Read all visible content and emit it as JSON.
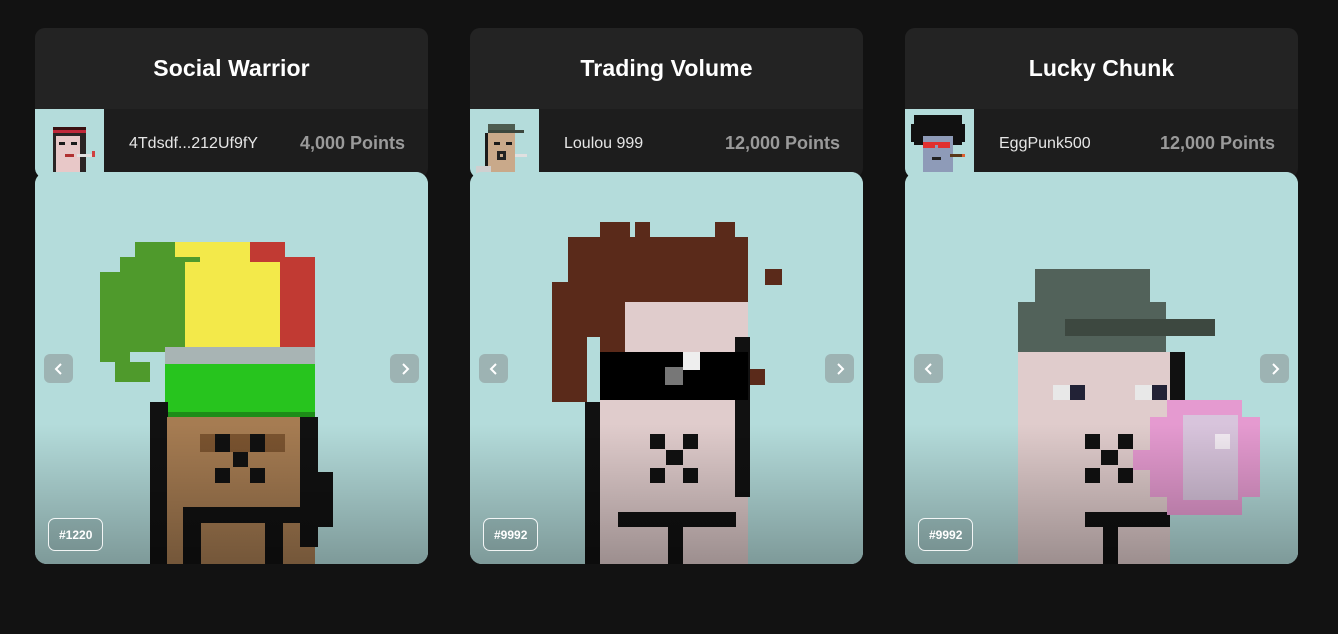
{
  "cards": [
    {
      "category": "Social Warrior",
      "winner_name": "4Tdsdf...212Uf9fY",
      "points": "4,000 Points",
      "token": "#1220",
      "avatar_icon": "punk-avatar-bandana",
      "prev_icon": "chevron-left-icon",
      "next_icon": "chevron-right-icon"
    },
    {
      "category": "Trading Volume",
      "winner_name": "Loulou 999",
      "points": "12,000 Points",
      "token": "#9992",
      "avatar_icon": "punk-avatar-cap",
      "prev_icon": "chevron-left-icon",
      "next_icon": "chevron-right-icon"
    },
    {
      "category": "Lucky Chunk",
      "winner_name": "EggPunk500",
      "points": "12,000 Points",
      "token": "#9992",
      "avatar_icon": "punk-avatar-afro",
      "prev_icon": "chevron-left-icon",
      "next_icon": "chevron-right-icon"
    }
  ],
  "colors": {
    "background": "#121212",
    "card": "#1d1d1d",
    "card_header": "#232323",
    "nft_background": "#b4dcdb",
    "points_text": "#9a9a9a"
  }
}
